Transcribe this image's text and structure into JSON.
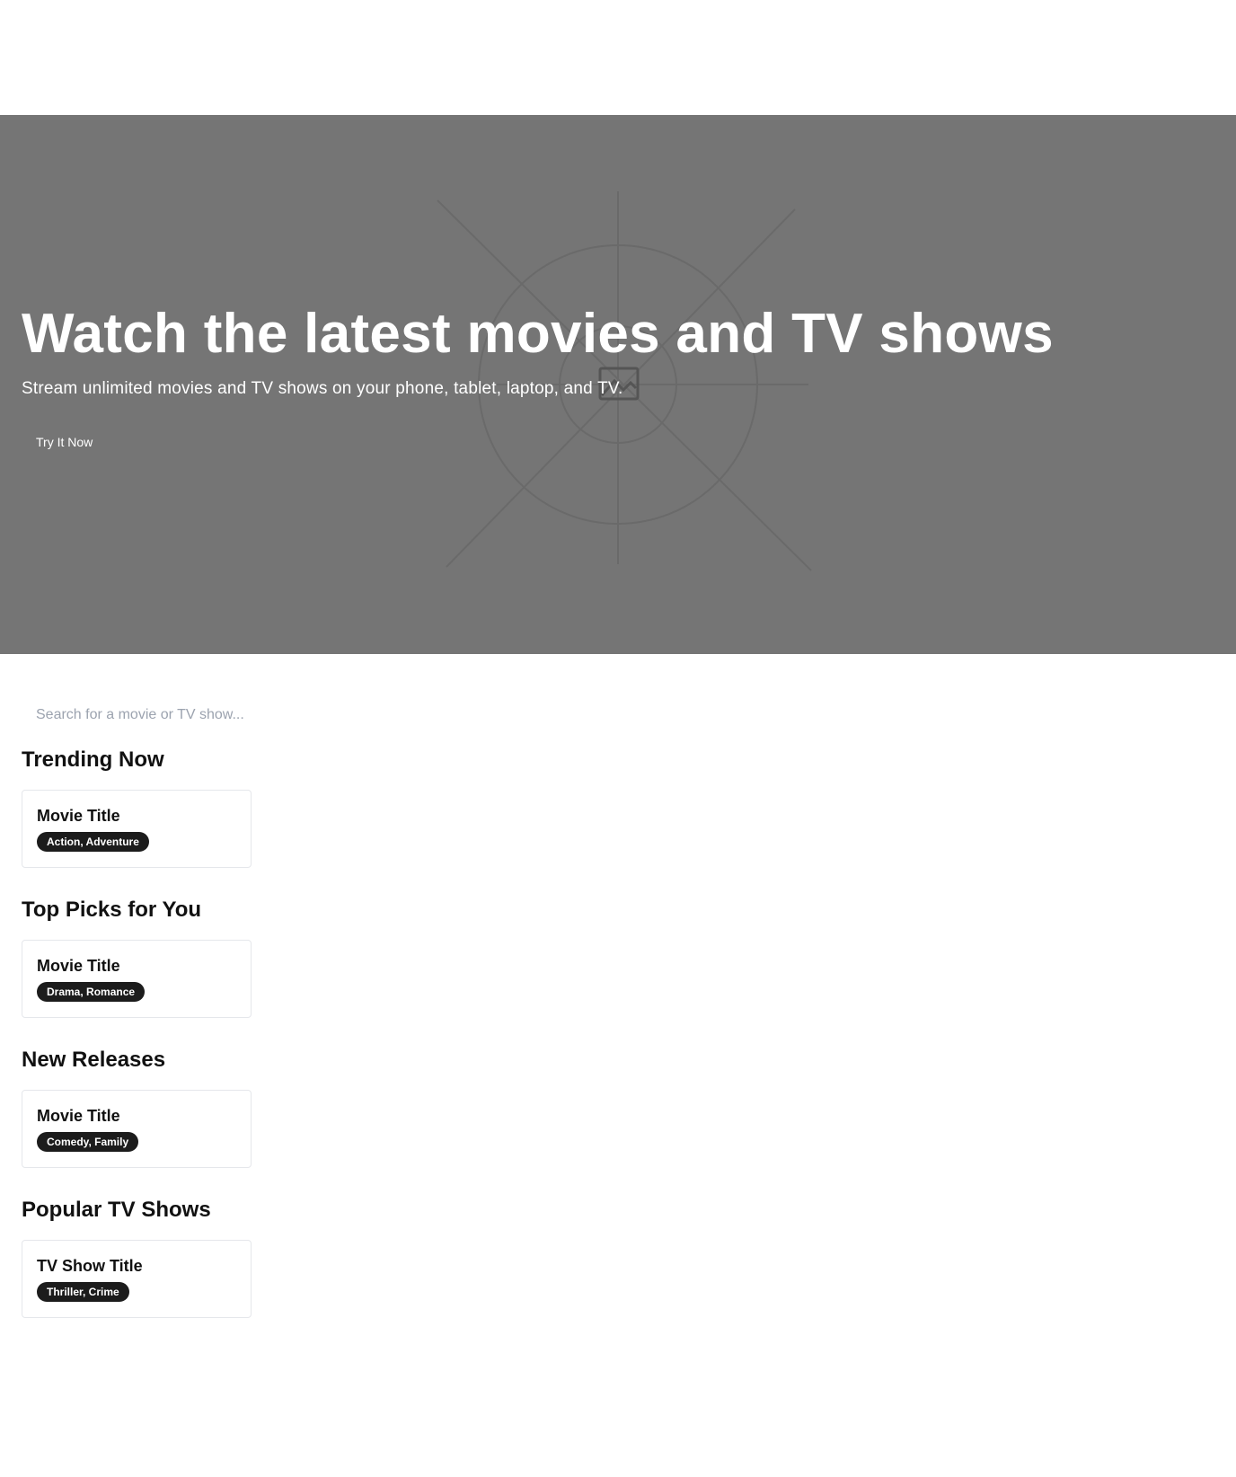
{
  "hero": {
    "title": "Watch the latest movies and TV shows",
    "subtitle": "Stream unlimited movies and TV shows on your phone, tablet, laptop, and TV.",
    "cta_label": "Try It Now",
    "background_color": "#757575",
    "placeholder_icon": "image-icon"
  },
  "search": {
    "placeholder": "Search for a movie or TV show..."
  },
  "sections": [
    {
      "title": "Trending Now",
      "card": {
        "title": "Movie Title",
        "genres": "Action, Adventure"
      }
    },
    {
      "title": "Top Picks for You",
      "card": {
        "title": "Movie Title",
        "genres": "Drama, Romance"
      }
    },
    {
      "title": "New Releases",
      "card": {
        "title": "Movie Title",
        "genres": "Comedy, Family"
      }
    },
    {
      "title": "Popular TV Shows",
      "card": {
        "title": "TV Show Title",
        "genres": "Thriller, Crime"
      }
    }
  ],
  "colors": {
    "badge_bg": "#1c1c1c",
    "card_border": "#e5e7eb"
  }
}
